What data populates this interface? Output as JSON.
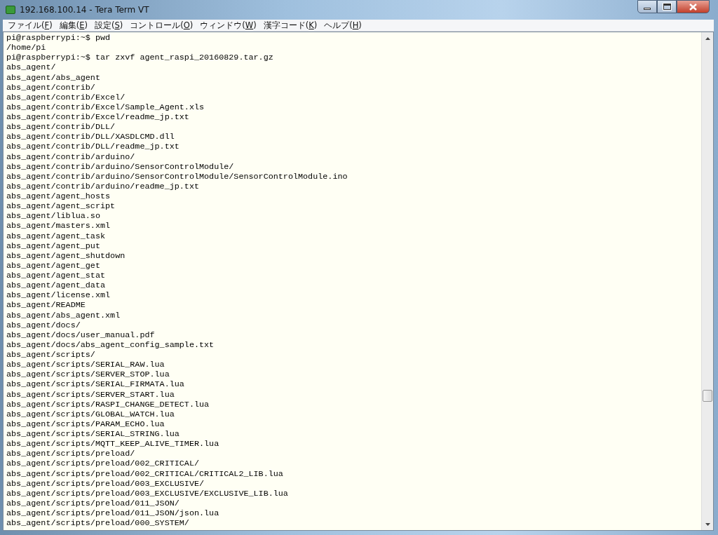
{
  "window": {
    "title": "192.168.100.14 - Tera Term VT"
  },
  "menu": [
    "ファイル(F)",
    "編集(E)",
    "設定(S)",
    "コントロール(O)",
    "ウィンドウ(W)",
    "漢字コード(K)",
    "ヘルプ(H)"
  ],
  "terminal": {
    "lines": [
      "pi@raspberrypi:~$ pwd",
      "/home/pi",
      "pi@raspberrypi:~$ tar zxvf agent_raspi_20160829.tar.gz",
      "abs_agent/",
      "abs_agent/abs_agent",
      "abs_agent/contrib/",
      "abs_agent/contrib/Excel/",
      "abs_agent/contrib/Excel/Sample_Agent.xls",
      "abs_agent/contrib/Excel/readme_jp.txt",
      "abs_agent/contrib/DLL/",
      "abs_agent/contrib/DLL/XASDLCMD.dll",
      "abs_agent/contrib/DLL/readme_jp.txt",
      "abs_agent/contrib/arduino/",
      "abs_agent/contrib/arduino/SensorControlModule/",
      "abs_agent/contrib/arduino/SensorControlModule/SensorControlModule.ino",
      "abs_agent/contrib/arduino/readme_jp.txt",
      "abs_agent/agent_hosts",
      "abs_agent/agent_script",
      "abs_agent/liblua.so",
      "abs_agent/masters.xml",
      "abs_agent/agent_task",
      "abs_agent/agent_put",
      "abs_agent/agent_shutdown",
      "abs_agent/agent_get",
      "abs_agent/agent_stat",
      "abs_agent/agent_data",
      "abs_agent/license.xml",
      "abs_agent/README",
      "abs_agent/abs_agent.xml",
      "abs_agent/docs/",
      "abs_agent/docs/user_manual.pdf",
      "abs_agent/docs/abs_agent_config_sample.txt",
      "abs_agent/scripts/",
      "abs_agent/scripts/SERIAL_RAW.lua",
      "abs_agent/scripts/SERVER_STOP.lua",
      "abs_agent/scripts/SERIAL_FIRMATA.lua",
      "abs_agent/scripts/SERVER_START.lua",
      "abs_agent/scripts/RASPI_CHANGE_DETECT.lua",
      "abs_agent/scripts/GLOBAL_WATCH.lua",
      "abs_agent/scripts/PARAM_ECHO.lua",
      "abs_agent/scripts/SERIAL_STRING.lua",
      "abs_agent/scripts/MQTT_KEEP_ALIVE_TIMER.lua",
      "abs_agent/scripts/preload/",
      "abs_agent/scripts/preload/002_CRITICAL/",
      "abs_agent/scripts/preload/002_CRITICAL/CRITICAL2_LIB.lua",
      "abs_agent/scripts/preload/003_EXCLUSIVE/",
      "abs_agent/scripts/preload/003_EXCLUSIVE/EXCLUSIVE_LIB.lua",
      "abs_agent/scripts/preload/011_JSON/",
      "abs_agent/scripts/preload/011_JSON/json.lua",
      "abs_agent/scripts/preload/000_SYSTEM/"
    ]
  }
}
